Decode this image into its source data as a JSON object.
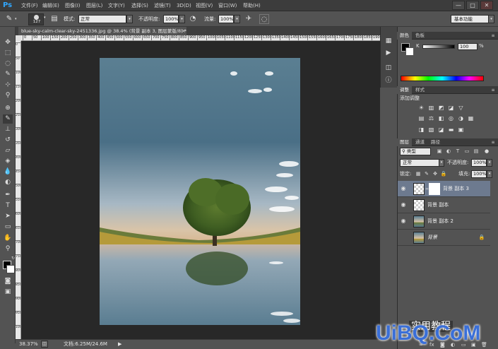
{
  "app": {
    "logo": "Ps"
  },
  "menu": {
    "items": [
      "文件(F)",
      "编辑(E)",
      "图像(I)",
      "图层(L)",
      "文字(Y)",
      "选择(S)",
      "滤镜(T)",
      "3D(D)",
      "视图(V)",
      "窗口(W)",
      "帮助(H)"
    ]
  },
  "window_controls": {
    "minimize": "—",
    "restore": "□",
    "close": "✕"
  },
  "options": {
    "brush_size": "127",
    "mode_label": "模式:",
    "mode_value": "正常",
    "opacity_label": "不透明度:",
    "opacity_value": "100%",
    "flow_label": "流量:",
    "flow_value": "100%",
    "workspace": "基本功能"
  },
  "document": {
    "tab_title": "blue-sky-calm-clear-sky-2451336.jpg @ 38.4% (背景 副本 3, 图层蒙版/8) *",
    "close": "×",
    "zoom": "38.37%",
    "doc_size": "文档:6.25M/24.6M",
    "status_arrow": "▶"
  },
  "ruler": {
    "h_ticks": [
      "0",
      "50",
      "100",
      "150",
      "200",
      "250",
      "300",
      "350",
      "400",
      "450",
      "500",
      "550",
      "600",
      "650",
      "700",
      "750",
      "800",
      "850",
      "900",
      "950",
      "1000",
      "1050",
      "1100",
      "1150",
      "1200",
      "1250",
      "1300",
      "1350",
      "1400",
      "1450",
      "1500",
      "1550",
      "1600",
      "1650",
      "1700",
      "1750",
      "1800",
      "1850",
      "1900",
      "1950",
      "2000"
    ],
    "v_ticks": [
      "0",
      "50",
      "100",
      "150",
      "200",
      "250",
      "300",
      "350",
      "400",
      "450",
      "500",
      "550",
      "600",
      "650",
      "700",
      "750",
      "800",
      "850",
      "900",
      "950",
      "1000"
    ]
  },
  "color_panel": {
    "tabs": [
      "颜色",
      "色板"
    ],
    "k_label": "K",
    "k_value": "100",
    "k_unit": "%"
  },
  "adjustments_panel": {
    "tabs": [
      "调整",
      "样式"
    ],
    "title": "添加调整"
  },
  "layers_panel": {
    "tabs": [
      "图层",
      "通道",
      "路径"
    ],
    "filter_value": "类型",
    "blend_mode": "正常",
    "opacity_label": "不透明度:",
    "opacity_value": "100%",
    "lock_label": "锁定:",
    "fill_label": "填充:",
    "fill_value": "100%",
    "layers": [
      {
        "name": "背景 副本 3",
        "selected": true,
        "has_mask": true
      },
      {
        "name": "背景 副本",
        "selected": false,
        "has_mask": false
      },
      {
        "name": "背景 副本 2",
        "selected": false,
        "has_mask": false
      },
      {
        "name": "背景",
        "selected": false,
        "has_mask": false,
        "locked": true
      }
    ]
  },
  "watermark": {
    "text": "UiBQ.CoM",
    "badge": "实用教程"
  },
  "colors": {
    "accent": "#31a8ff",
    "selected_layer": "#6d7a8f",
    "watermark": "#3a6fd8"
  }
}
